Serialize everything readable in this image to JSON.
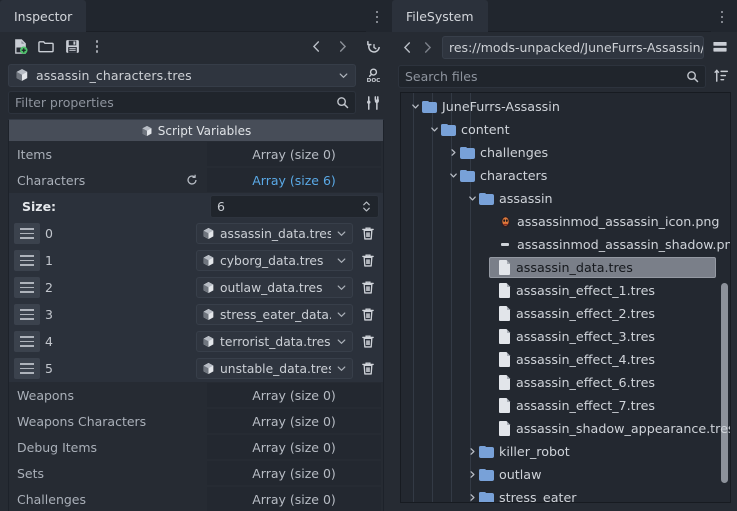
{
  "inspector": {
    "tab_label": "Inspector",
    "menu_icon": "kebab-menu-icon",
    "toolbar": {
      "new_resource": "new-resource-icon",
      "open_resource": "open-folder-icon",
      "save_resource": "save-icon",
      "more": "kebab-menu-icon",
      "history_prev": "chevron-left-icon",
      "history_next": "chevron-right-icon",
      "history": "history-icon"
    },
    "resource": {
      "icon": "resource-preload-icon",
      "name": "assassin_characters.tres",
      "dropdown_icon": "chevron-down-icon",
      "docs_icon": "search-docs-icon"
    },
    "filter": {
      "placeholder": "Filter properties",
      "search_icon": "search-icon",
      "tools_icon": "object-tools-icon"
    },
    "section": {
      "label": "Script Variables",
      "icon": "script-variables-icon"
    },
    "properties_top": [
      {
        "name": "Items",
        "value": "Array (size 0)",
        "accent": false,
        "revert": false
      },
      {
        "name": "Characters",
        "value": "Array (size 6)",
        "accent": true,
        "revert": true
      }
    ],
    "size_row": {
      "label": "Size:",
      "value": "6",
      "stepper_icon": "updown-arrows-icon"
    },
    "array_items": [
      {
        "index": "0",
        "resource": "assassin_data.tres"
      },
      {
        "index": "1",
        "resource": "cyborg_data.tres"
      },
      {
        "index": "2",
        "resource": "outlaw_data.tres"
      },
      {
        "index": "3",
        "resource": "stress_eater_data.t"
      },
      {
        "index": "4",
        "resource": "terrorist_data.tres"
      },
      {
        "index": "5",
        "resource": "unstable_data.tres"
      }
    ],
    "array_item_icons": {
      "drag_handle": "drag-handle-icon",
      "resource_icon": "resource-preload-icon",
      "dropdown": "chevron-down-icon",
      "delete": "trash-icon"
    },
    "properties_bottom": [
      {
        "name": "Weapons",
        "value": "Array (size 0)"
      },
      {
        "name": "Weapons Characters",
        "value": "Array (size 0)"
      },
      {
        "name": "Debug Items",
        "value": "Array (size 0)"
      },
      {
        "name": "Sets",
        "value": "Array (size 0)"
      },
      {
        "name": "Challenges",
        "value": "Array (size 0)"
      }
    ]
  },
  "filesystem": {
    "tab_label": "FileSystem",
    "menu_icon": "kebab-menu-icon",
    "nav": {
      "back_icon": "chevron-left-icon",
      "forward_icon": "chevron-right-icon",
      "path": "res://mods-unpacked/JuneFurrs-Assassin/cont",
      "split_icon": "toggle-split-mode-icon"
    },
    "search": {
      "placeholder": "Search files",
      "search_icon": "search-icon",
      "sort_icon": "sort-options-icon"
    },
    "tree": [
      {
        "label": "JuneFurrs-Assassin",
        "depth": 1,
        "type": "folder",
        "state": "open",
        "selected": false
      },
      {
        "label": "content",
        "depth": 2,
        "type": "folder",
        "state": "open",
        "selected": false
      },
      {
        "label": "challenges",
        "depth": 3,
        "type": "folder",
        "state": "closed",
        "selected": false
      },
      {
        "label": "characters",
        "depth": 3,
        "type": "folder",
        "state": "open",
        "selected": false
      },
      {
        "label": "assassin",
        "depth": 4,
        "type": "folder",
        "state": "open",
        "selected": false
      },
      {
        "label": "assassinmod_assassin_icon.png",
        "depth": 5,
        "type": "image",
        "state": "leaf",
        "selected": false
      },
      {
        "label": "assassinmod_assassin_shadow.png",
        "depth": 5,
        "type": "dash",
        "state": "leaf",
        "selected": false
      },
      {
        "label": "assassin_data.tres",
        "depth": 5,
        "type": "file",
        "state": "leaf",
        "selected": true
      },
      {
        "label": "assassin_effect_1.tres",
        "depth": 5,
        "type": "file",
        "state": "leaf",
        "selected": false
      },
      {
        "label": "assassin_effect_2.tres",
        "depth": 5,
        "type": "file",
        "state": "leaf",
        "selected": false
      },
      {
        "label": "assassin_effect_3.tres",
        "depth": 5,
        "type": "file",
        "state": "leaf",
        "selected": false
      },
      {
        "label": "assassin_effect_4.tres",
        "depth": 5,
        "type": "file",
        "state": "leaf",
        "selected": false
      },
      {
        "label": "assassin_effect_6.tres",
        "depth": 5,
        "type": "file",
        "state": "leaf",
        "selected": false
      },
      {
        "label": "assassin_effect_7.tres",
        "depth": 5,
        "type": "file",
        "state": "leaf",
        "selected": false
      },
      {
        "label": "assassin_shadow_appearance.tres",
        "depth": 5,
        "type": "file",
        "state": "leaf",
        "selected": false
      },
      {
        "label": "killer_robot",
        "depth": 4,
        "type": "folder",
        "state": "closed",
        "selected": false
      },
      {
        "label": "outlaw",
        "depth": 4,
        "type": "folder",
        "state": "closed",
        "selected": false
      },
      {
        "label": "stress_eater",
        "depth": 4,
        "type": "folder",
        "state": "closed",
        "selected": false
      }
    ]
  },
  "colors": {
    "accent": "#5aa9e6",
    "folder": "#78a1d8",
    "panel_bg": "#262b33",
    "tab_bg": "#2b313b",
    "window_bg": "#21262e",
    "selection": "#7a7f89"
  }
}
